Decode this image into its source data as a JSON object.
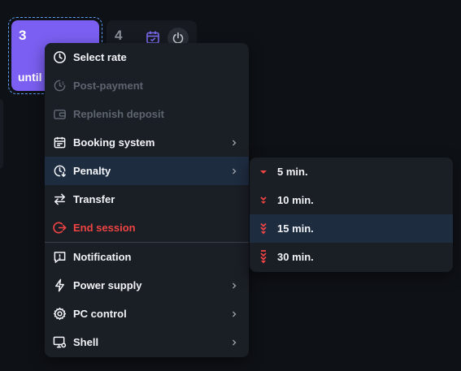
{
  "colors": {
    "accent_purple": "#7b5ff2",
    "danger": "#f04444",
    "penalty_icon": "#f04444",
    "active_row": "#1e2c40",
    "selection_outline": "#5b9cf5"
  },
  "tiles": [
    {
      "number": "3",
      "subtitle": "until",
      "selected": true
    },
    {
      "number": "4",
      "icons": [
        "calendar-check-icon",
        "power-icon"
      ]
    }
  ],
  "menu": {
    "items": [
      {
        "label": "Select rate",
        "icon": "clock-icon"
      },
      {
        "label": "Post-payment",
        "icon": "clock-dollar-icon",
        "disabled": true
      },
      {
        "label": "Replenish deposit",
        "icon": "wallet-icon",
        "disabled": true
      },
      {
        "label": "Booking system",
        "icon": "calendar-icon",
        "submenu": true
      },
      {
        "label": "Penalty",
        "icon": "clock-down-icon",
        "submenu": true,
        "active": true
      },
      {
        "label": "Transfer",
        "icon": "arrows-transfer-icon"
      },
      {
        "label": "End session",
        "icon": "logout-icon",
        "danger": true
      },
      {
        "label": "Notification",
        "icon": "message-alert-icon"
      },
      {
        "label": "Power supply",
        "icon": "lightning-icon",
        "submenu": true
      },
      {
        "label": "PC control",
        "icon": "gear-icon",
        "submenu": true
      },
      {
        "label": "Shell",
        "icon": "monitor-settings-icon",
        "submenu": true
      }
    ]
  },
  "penalty_submenu": {
    "items": [
      {
        "label": "5 min.",
        "level": 1
      },
      {
        "label": "10 min.",
        "level": 2
      },
      {
        "label": "15 min.",
        "level": 3,
        "active": true
      },
      {
        "label": "30 min.",
        "level": 4
      }
    ]
  }
}
